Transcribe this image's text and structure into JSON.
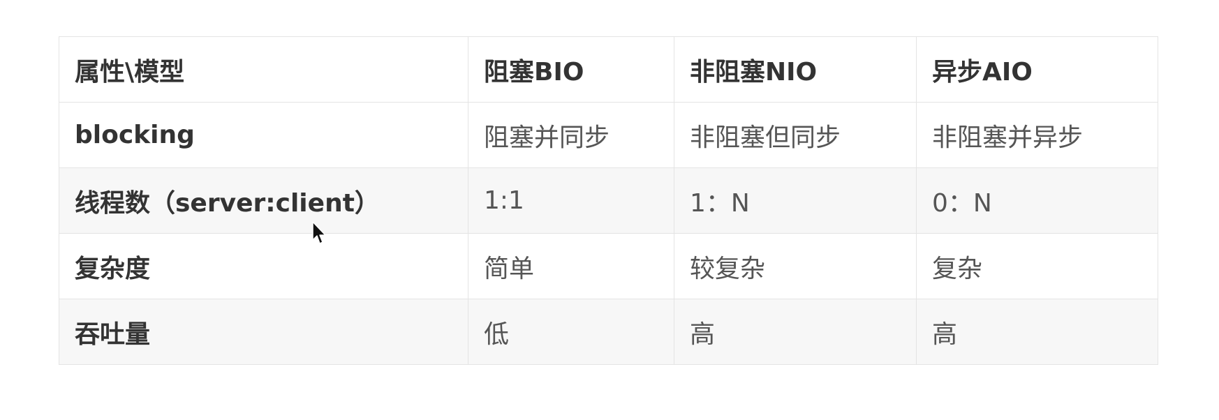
{
  "table": {
    "headers": [
      "属性\\模型",
      "阻塞BIO",
      "非阻塞NIO",
      "异步AIO"
    ],
    "rows": [
      [
        "blocking",
        "阻塞并同步",
        "非阻塞但同步",
        "非阻塞并异步"
      ],
      [
        "线程数（server:client）",
        "1:1",
        "1：N",
        "0：N"
      ],
      [
        "复杂度",
        "简单",
        "较复杂",
        "复杂"
      ],
      [
        "吞吐量",
        "低",
        "高",
        "高"
      ]
    ]
  },
  "colors": {
    "border": "#e4e4e4",
    "zebra_row": "#f7f7f7",
    "text_bold": "#333333",
    "text_normal": "#555555"
  },
  "cursor": {
    "icon": "mouse-pointer-icon"
  }
}
